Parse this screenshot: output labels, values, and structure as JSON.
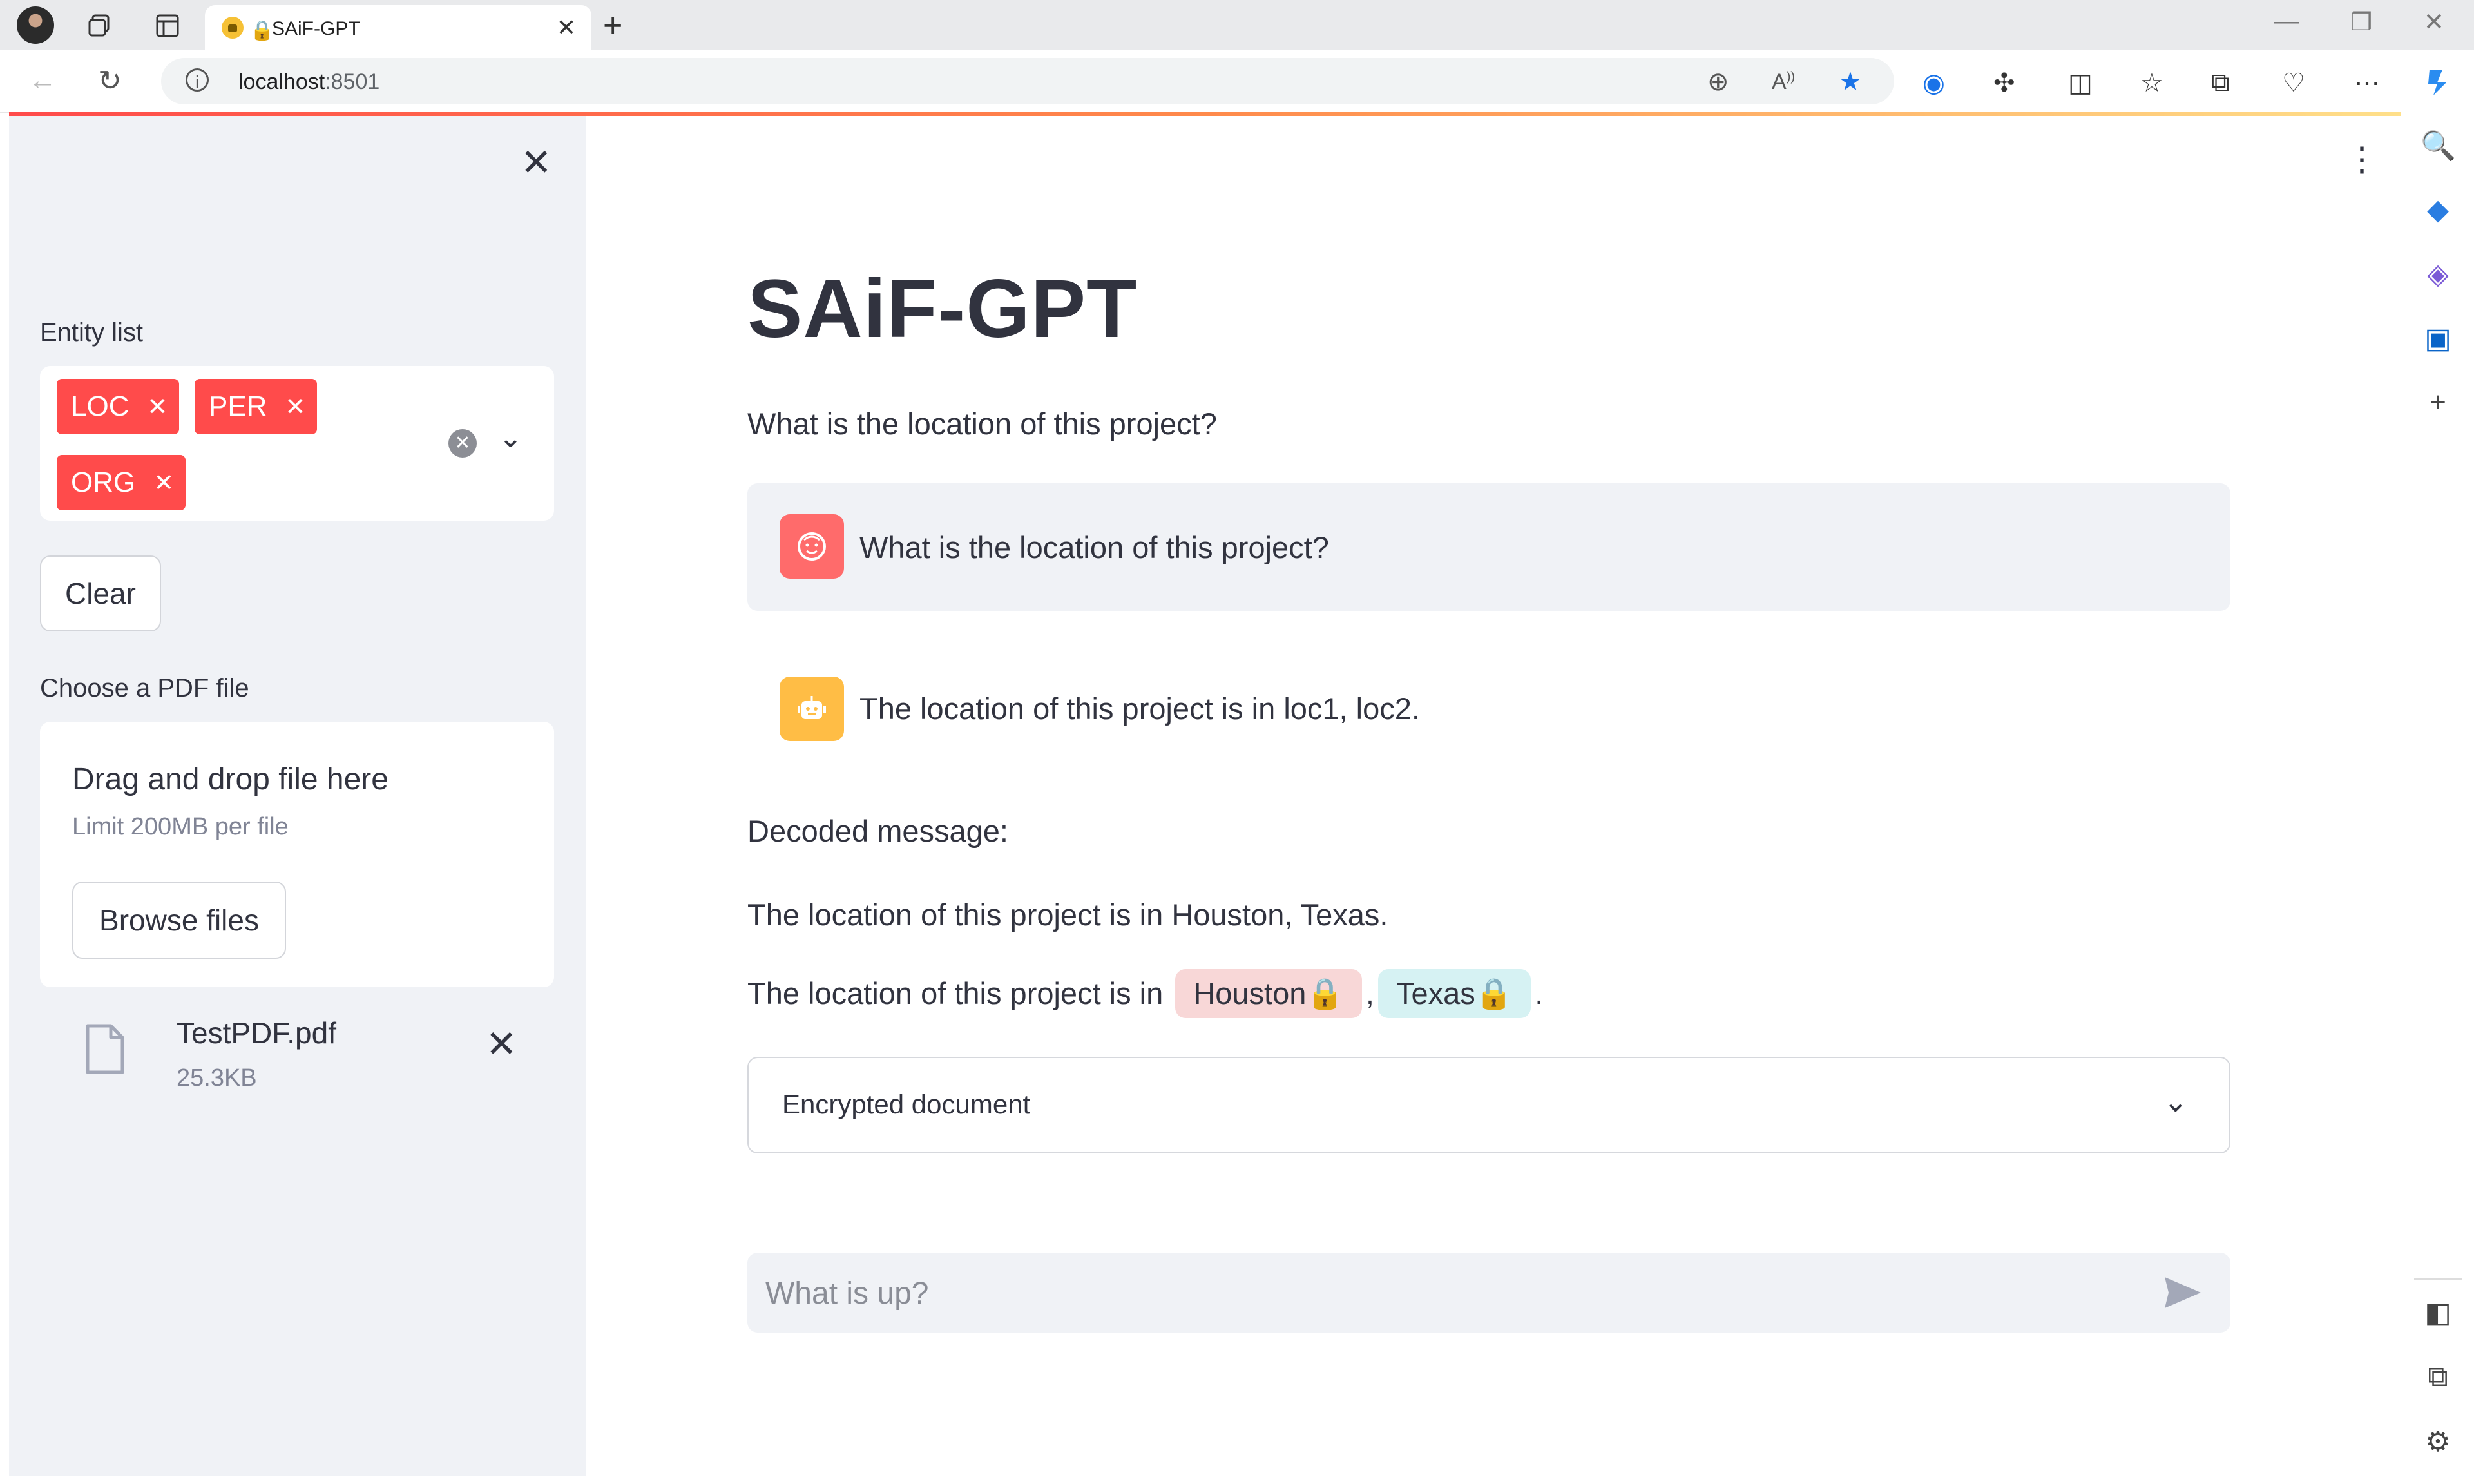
{
  "browser": {
    "tab_title": "SAiF-GPT",
    "url_host": "localhost",
    "url_port": ":8501"
  },
  "sidebar": {
    "entity_list_label": "Entity list",
    "entities": [
      "LOC",
      "PER",
      "ORG"
    ],
    "clear_label": "Clear",
    "pdf_label": "Choose a PDF file",
    "uploader": {
      "drag_text": "Drag and drop file here",
      "limit_text": "Limit 200MB per file",
      "browse_label": "Browse files"
    },
    "file": {
      "name": "TestPDF.pdf",
      "size": "25.3KB"
    }
  },
  "main": {
    "title": "SAiF-GPT",
    "question": "What is the location of this project?",
    "user_message": "What is the location of this project?",
    "assistant_message": "The location of this project is in loc1, loc2.",
    "decoded_label": "Decoded message:",
    "decoded_text": "The location of this project is in Houston, Texas.",
    "annotated_prefix": "The location of this project is in ",
    "annotated_entities": [
      {
        "text": "Houston",
        "bg": "#f8d7d7"
      },
      {
        "text": "Texas",
        "bg": "#d6f2f3"
      }
    ],
    "annotated_sep": ",",
    "annotated_suffix": ".",
    "expander_label": "Encrypted document",
    "chat_placeholder": "What is up?"
  },
  "colors": {
    "accent": "#ff4b4b",
    "user_avatar": "#ff6b6b",
    "assistant_avatar": "#ffbd45",
    "sidebar_bg": "#f0f2f6"
  }
}
